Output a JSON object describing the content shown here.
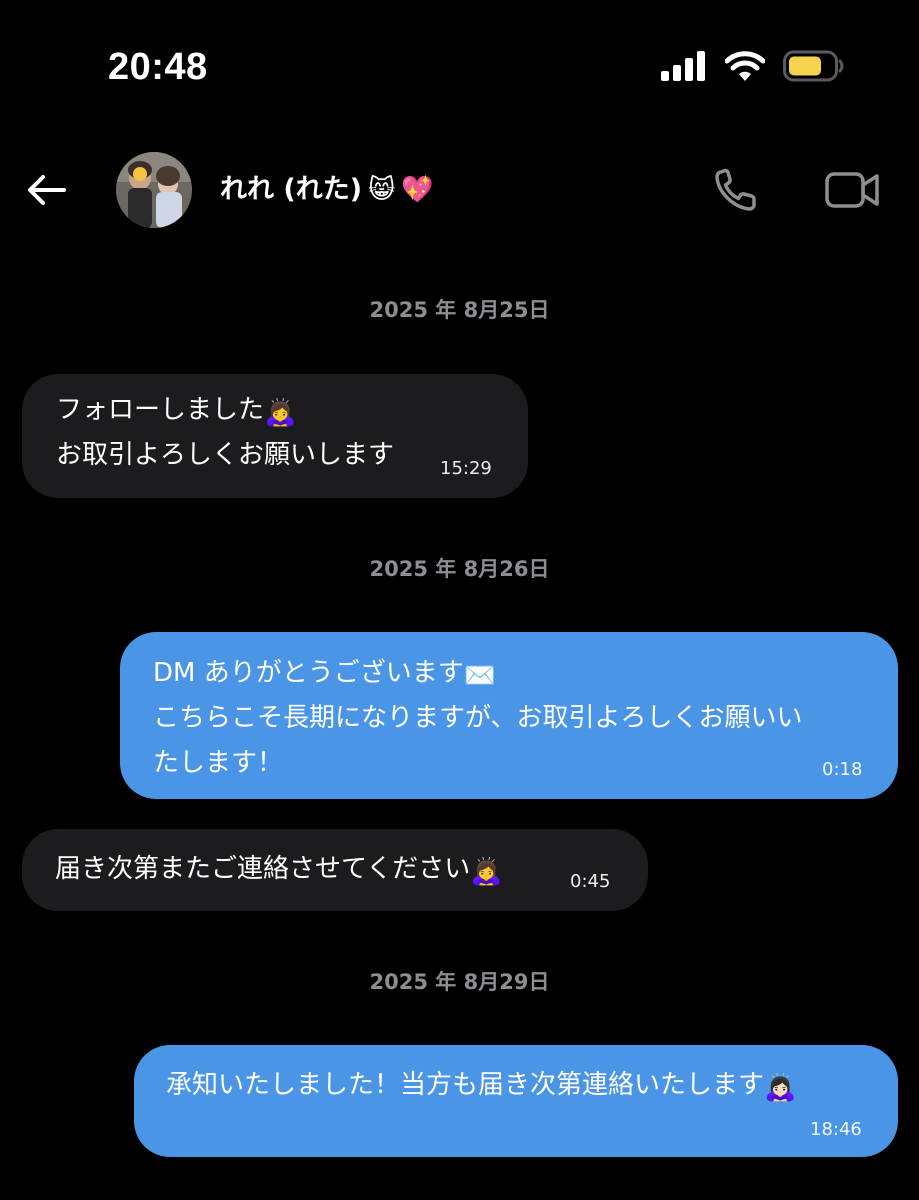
{
  "status_bar": {
    "time": "20:48"
  },
  "header": {
    "contact_name": "れれ (れた)",
    "name_emojis": [
      "😸",
      "💖"
    ],
    "icons": [
      "back-arrow-icon",
      "phone-icon",
      "video-camera-icon"
    ]
  },
  "messages": [
    {
      "date": "2025 年 8月25日",
      "items": [
        {
          "direction": "incoming",
          "lines": [
            "フォローしました",
            "お取引よろしくお願いします"
          ],
          "emojis": [
            "🙇‍♀️"
          ],
          "time": "15:29"
        }
      ]
    },
    {
      "date": "2025 年 8月26日",
      "items": [
        {
          "direction": "outgoing",
          "lines": [
            "DM ありがとうございます",
            "こちらこそ長期になりますが、お取引よろしくお願いい",
            "たします！"
          ],
          "emojis": [
            "✉️"
          ],
          "time": "0:18"
        },
        {
          "direction": "incoming",
          "lines": [
            "届き次第またご連絡させてください"
          ],
          "emojis": [
            "🙇‍♀️"
          ],
          "time": "0:45"
        }
      ]
    },
    {
      "date": "2025 年 8月29日",
      "items": [
        {
          "direction": "outgoing",
          "lines": [
            "承知いたしました！当方も届き次第連絡いたします"
          ],
          "emojis": [
            "🙇🏻‍♀️"
          ],
          "time": "18:46"
        }
      ]
    }
  ],
  "colors": {
    "background": "#000000",
    "incoming_bubble": "#1c1c1e",
    "outgoing_bubble": "#4a95e5",
    "date_text": "#8d8d92",
    "battery_fill": "#f5d34f"
  }
}
